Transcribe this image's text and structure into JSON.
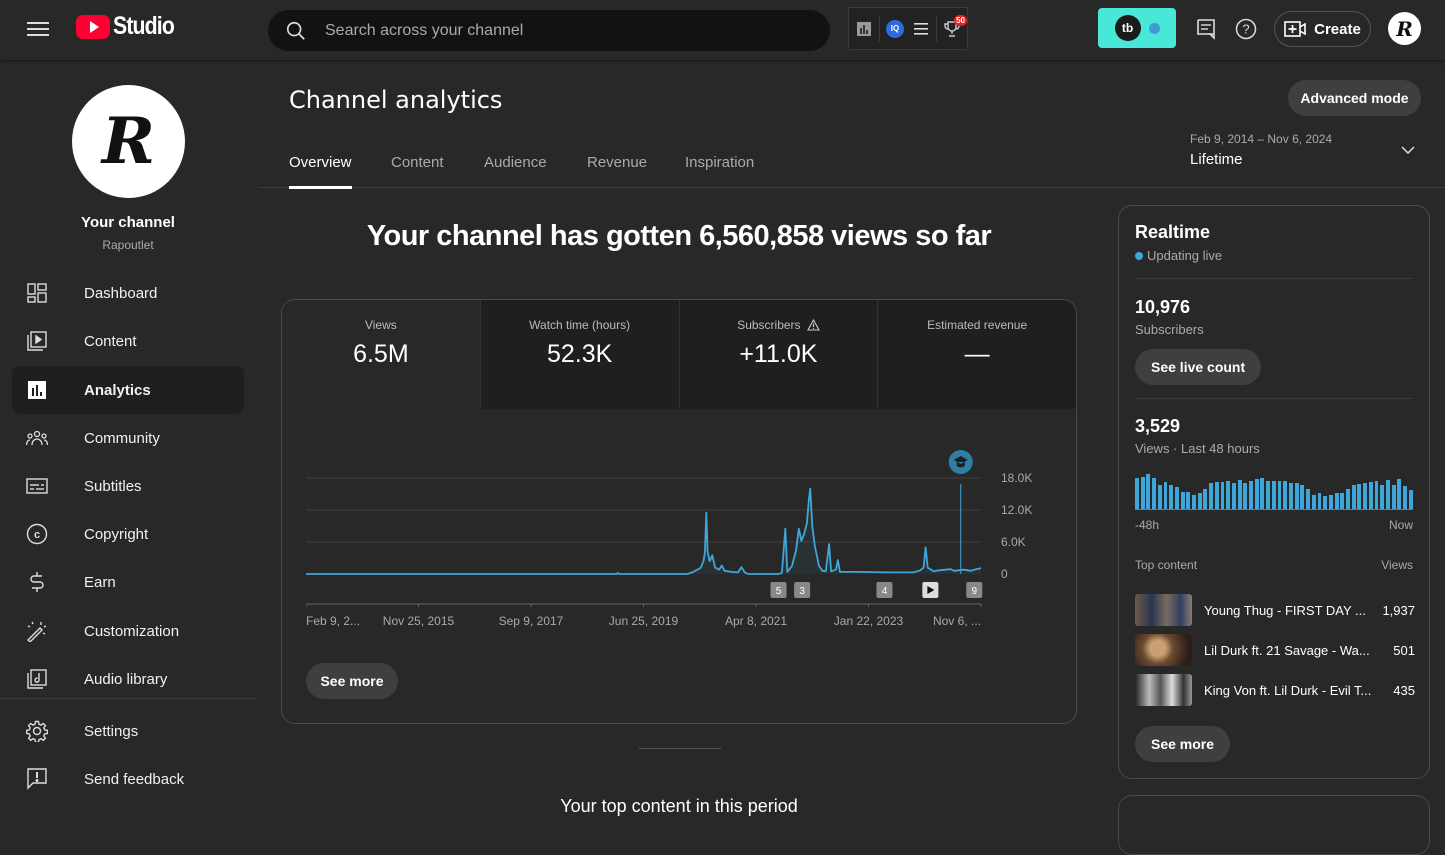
{
  "topbar": {
    "logo_text": "Studio",
    "search_placeholder": "Search across your channel",
    "extensions": {
      "analytics_icon": "bar-chart-icon",
      "iq_label": "IQ",
      "trophy_badge": "50"
    },
    "tubebuddy_label": "tb",
    "create_label": "Create",
    "avatar_letter": "R"
  },
  "sidebar": {
    "channel_title": "Your channel",
    "channel_handle": "Rapoutlet",
    "avatar_letter": "R",
    "items": [
      {
        "label": "Dashboard",
        "icon": "dashboard-icon"
      },
      {
        "label": "Content",
        "icon": "content-icon"
      },
      {
        "label": "Analytics",
        "icon": "analytics-icon",
        "active": true
      },
      {
        "label": "Community",
        "icon": "community-icon"
      },
      {
        "label": "Subtitles",
        "icon": "subtitles-icon"
      },
      {
        "label": "Copyright",
        "icon": "copyright-icon"
      },
      {
        "label": "Earn",
        "icon": "dollar-icon"
      },
      {
        "label": "Customization",
        "icon": "magic-wand-icon"
      },
      {
        "label": "Audio library",
        "icon": "audio-library-icon"
      }
    ],
    "footer_items": [
      {
        "label": "Settings",
        "icon": "gear-icon"
      },
      {
        "label": "Send feedback",
        "icon": "feedback-icon"
      }
    ]
  },
  "header": {
    "title": "Channel analytics",
    "advanced_mode_label": "Advanced mode",
    "tabs": [
      "Overview",
      "Content",
      "Audience",
      "Revenue",
      "Inspiration"
    ],
    "active_tab": "Overview",
    "date_range": "Feb 9, 2014 – Nov 6, 2024",
    "date_preset": "Lifetime"
  },
  "overview": {
    "headline": "Your channel has gotten 6,560,858 views so far",
    "metrics": [
      {
        "label": "Views",
        "value": "6.5M"
      },
      {
        "label": "Watch time (hours)",
        "value": "52.3K"
      },
      {
        "label": "Subscribers",
        "value": "+11.0K",
        "warning": true
      },
      {
        "label": "Estimated revenue",
        "value": "—"
      }
    ],
    "see_more_label": "See more",
    "top_content_heading": "Your top content in this period"
  },
  "chart_data": {
    "type": "line",
    "title": "Views",
    "xlabel": "",
    "ylabel": "",
    "x_tick_labels": [
      "Feb 9, 2...",
      "Nov 25, 2015",
      "Sep 9, 2017",
      "Jun 25, 2019",
      "Apr 8, 2021",
      "Jan 22, 2023",
      "Nov 6, ..."
    ],
    "y_tick_labels": [
      "0",
      "6.0K",
      "12.0K",
      "18.0K"
    ],
    "ylim": [
      0,
      18000
    ],
    "grid": true,
    "x_range": [
      "2014-02-09",
      "2024-11-06"
    ],
    "series": [
      {
        "name": "Views",
        "color": "#3ea6d8",
        "points": [
          [
            0.0,
            0
          ],
          [
            0.46,
            0
          ],
          [
            0.462,
            200
          ],
          [
            0.464,
            0
          ],
          [
            0.565,
            0
          ],
          [
            0.572,
            300
          ],
          [
            0.58,
            800
          ],
          [
            0.585,
            1200
          ],
          [
            0.589,
            2500
          ],
          [
            0.591,
            4000
          ],
          [
            0.593,
            11500
          ],
          [
            0.595,
            4200
          ],
          [
            0.598,
            2400
          ],
          [
            0.602,
            3500
          ],
          [
            0.606,
            1200
          ],
          [
            0.612,
            800
          ],
          [
            0.616,
            1600
          ],
          [
            0.62,
            600
          ],
          [
            0.63,
            400
          ],
          [
            0.64,
            300
          ],
          [
            0.645,
            1300
          ],
          [
            0.65,
            300
          ],
          [
            0.655,
            0
          ],
          [
            0.7,
            0
          ],
          [
            0.705,
            200
          ],
          [
            0.71,
            8500
          ],
          [
            0.713,
            400
          ],
          [
            0.72,
            1500
          ],
          [
            0.726,
            4500
          ],
          [
            0.73,
            8500
          ],
          [
            0.734,
            6200
          ],
          [
            0.738,
            7500
          ],
          [
            0.742,
            9500
          ],
          [
            0.745,
            14000
          ],
          [
            0.747,
            16000
          ],
          [
            0.75,
            9000
          ],
          [
            0.754,
            5200
          ],
          [
            0.76,
            1500
          ],
          [
            0.765,
            600
          ],
          [
            0.77,
            500
          ],
          [
            0.775,
            5600
          ],
          [
            0.778,
            500
          ],
          [
            0.785,
            800
          ],
          [
            0.788,
            2600
          ],
          [
            0.791,
            400
          ],
          [
            0.82,
            400
          ],
          [
            0.86,
            300
          ],
          [
            0.9,
            300
          ],
          [
            0.91,
            700
          ],
          [
            0.915,
            1200
          ],
          [
            0.918,
            5000
          ],
          [
            0.921,
            1200
          ],
          [
            0.93,
            500
          ],
          [
            0.96,
            600
          ],
          [
            0.99,
            800
          ],
          [
            1.0,
            1100
          ],
          [
            0.938,
            700
          ],
          [
            0.955,
            900
          ],
          [
            0.975,
            800
          ],
          [
            0.985,
            600
          ]
        ]
      }
    ],
    "annotations": [
      {
        "type": "marker",
        "label": "5",
        "x_fraction": 0.7
      },
      {
        "type": "marker",
        "label": "3",
        "x_fraction": 0.735
      },
      {
        "type": "marker",
        "label": "4",
        "x_fraction": 0.857
      },
      {
        "type": "marker",
        "label": "play",
        "x_fraction": 0.925
      },
      {
        "type": "marker",
        "label": "9",
        "x_fraction": 0.99
      },
      {
        "type": "milestone",
        "icon": "graduation-cap-icon",
        "x_fraction": 0.97
      }
    ]
  },
  "realtime": {
    "title": "Realtime",
    "status": "Updating live",
    "subscribers": "10,976",
    "subscribers_label": "Subscribers",
    "live_count_label": "See live count",
    "views": "3,529",
    "views_label": "Views · Last 48 hours",
    "axis_start": "-48h",
    "axis_end": "Now",
    "hourly_views_relative": [
      88,
      92,
      100,
      90,
      70,
      78,
      68,
      62,
      48,
      48,
      40,
      46,
      56,
      73,
      78,
      78,
      80,
      74,
      82,
      75,
      80,
      86,
      88,
      80,
      80,
      80,
      80,
      74,
      74,
      70,
      58,
      40,
      46,
      36,
      40,
      46,
      46,
      58,
      68,
      72,
      75,
      78,
      80,
      70,
      82,
      70,
      85,
      65,
      54
    ],
    "top_content_label": "Top content",
    "views_col_label": "Views",
    "top_content": [
      {
        "title": "Young Thug - FIRST DAY ...",
        "views": "1,937"
      },
      {
        "title": "Lil Durk ft. 21 Savage - Wa...",
        "views": "501"
      },
      {
        "title": "King Von ft. Lil Durk - Evil T...",
        "views": "435"
      }
    ],
    "see_more_label": "See more"
  }
}
